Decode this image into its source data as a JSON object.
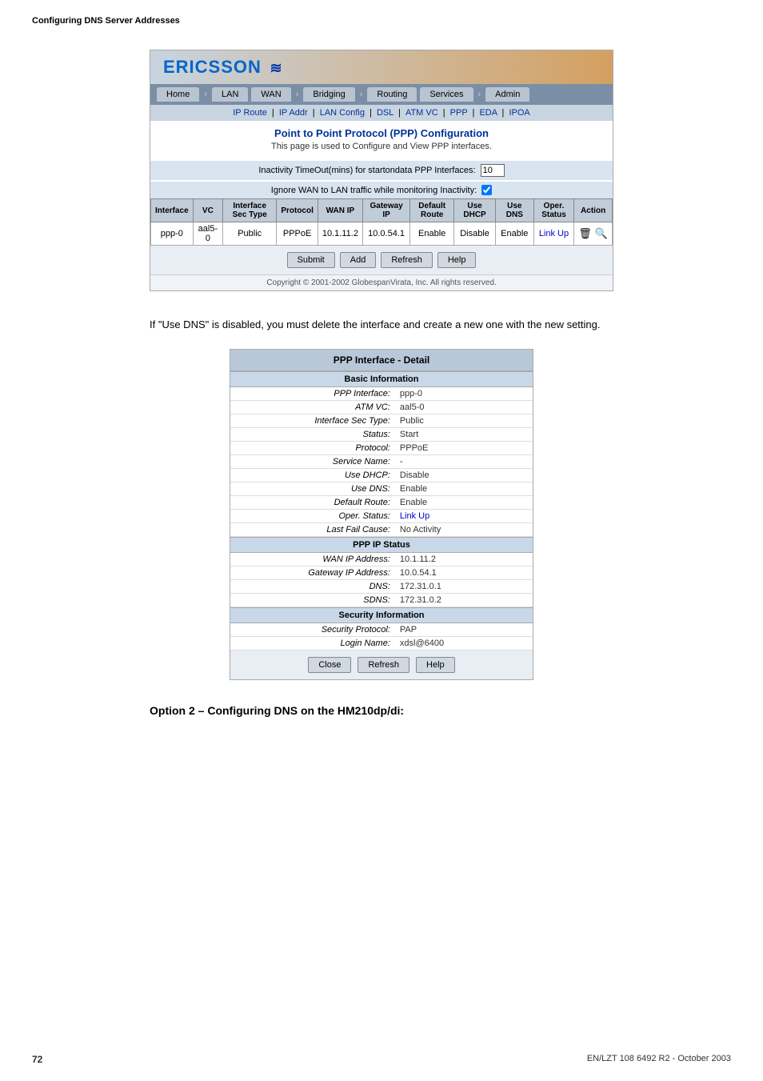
{
  "page": {
    "header": "Configuring DNS Server Addresses",
    "footer_left": "72",
    "footer_right": "EN/LZT 108 6492 R2  -  October 2003"
  },
  "router_ui": {
    "brand": "ERICSSON",
    "nav": {
      "items": [
        "Home",
        "LAN",
        "WAN",
        "Bridging",
        "Routing",
        "Services",
        "Admin"
      ]
    },
    "sub_nav": {
      "items": [
        "IP Route",
        "IP Addr",
        "LAN Config",
        "DSL",
        "ATM VC",
        "PPP",
        "EDA",
        "IPOA"
      ]
    },
    "page_title": "Point to Point Protocol (PPP) Configuration",
    "page_subtitle": "This page is used to Configure and View PPP interfaces.",
    "config_label1": "Inactivity TimeOut(mins) for startondata PPP Interfaces:",
    "config_value1": "10",
    "config_label2": "Ignore WAN to LAN traffic while monitoring Inactivity:",
    "table": {
      "headers": [
        "Interface",
        "VC",
        "Interface Sec Type",
        "Protocol",
        "WAN IP",
        "Gateway IP",
        "Default Route",
        "Use DHCP",
        "Use DNS",
        "Oper. Status",
        "Action"
      ],
      "rows": [
        [
          "ppp-0",
          "aal5-0",
          "Public",
          "",
          "PPPoE",
          "10.1.11.2",
          "10.0.54.1",
          "Enable",
          "Disable",
          "Enable",
          "Link Up"
        ]
      ]
    },
    "buttons": [
      "Submit",
      "Add",
      "Refresh",
      "Help"
    ],
    "copyright": "Copyright © 2001-2002 GlobespanVirata, Inc. All rights reserved."
  },
  "description": "If \"Use DNS\" is disabled, you must delete the interface and create a new one with the new setting.",
  "detail_box": {
    "title": "PPP Interface - Detail",
    "sections": [
      {
        "header": "Basic Information",
        "rows": [
          {
            "label": "PPP Interface:",
            "value": "ppp-0"
          },
          {
            "label": "ATM VC:",
            "value": "aal5-0"
          },
          {
            "label": "Interface Sec Type:",
            "value": "Public"
          },
          {
            "label": "Status:",
            "value": "Start"
          },
          {
            "label": "Protocol:",
            "value": "PPPoE"
          },
          {
            "label": "Service Name:",
            "value": "-"
          },
          {
            "label": "Use DHCP:",
            "value": "Disable"
          },
          {
            "label": "Use DNS:",
            "value": "Enable"
          },
          {
            "label": "Default Route:",
            "value": "Enable"
          },
          {
            "label": "Oper. Status:",
            "value": "Link Up"
          },
          {
            "label": "Last Fail Cause:",
            "value": "No Activity"
          }
        ]
      },
      {
        "header": "PPP IP Status",
        "rows": [
          {
            "label": "WAN IP Address:",
            "value": "10.1.11.2"
          },
          {
            "label": "Gateway IP Address:",
            "value": "10.0.54.1"
          },
          {
            "label": "DNS:",
            "value": "172.31.0.1"
          },
          {
            "label": "SDNS:",
            "value": "172.31.0.2"
          }
        ]
      },
      {
        "header": "Security Information",
        "rows": [
          {
            "label": "Security Protocol:",
            "value": "PAP"
          },
          {
            "label": "Login Name:",
            "value": "xdsl@6400"
          }
        ]
      }
    ],
    "buttons": [
      "Close",
      "Refresh",
      "Help"
    ]
  },
  "option_heading": "Option 2 – Configuring DNS on the HM210dp/di:"
}
